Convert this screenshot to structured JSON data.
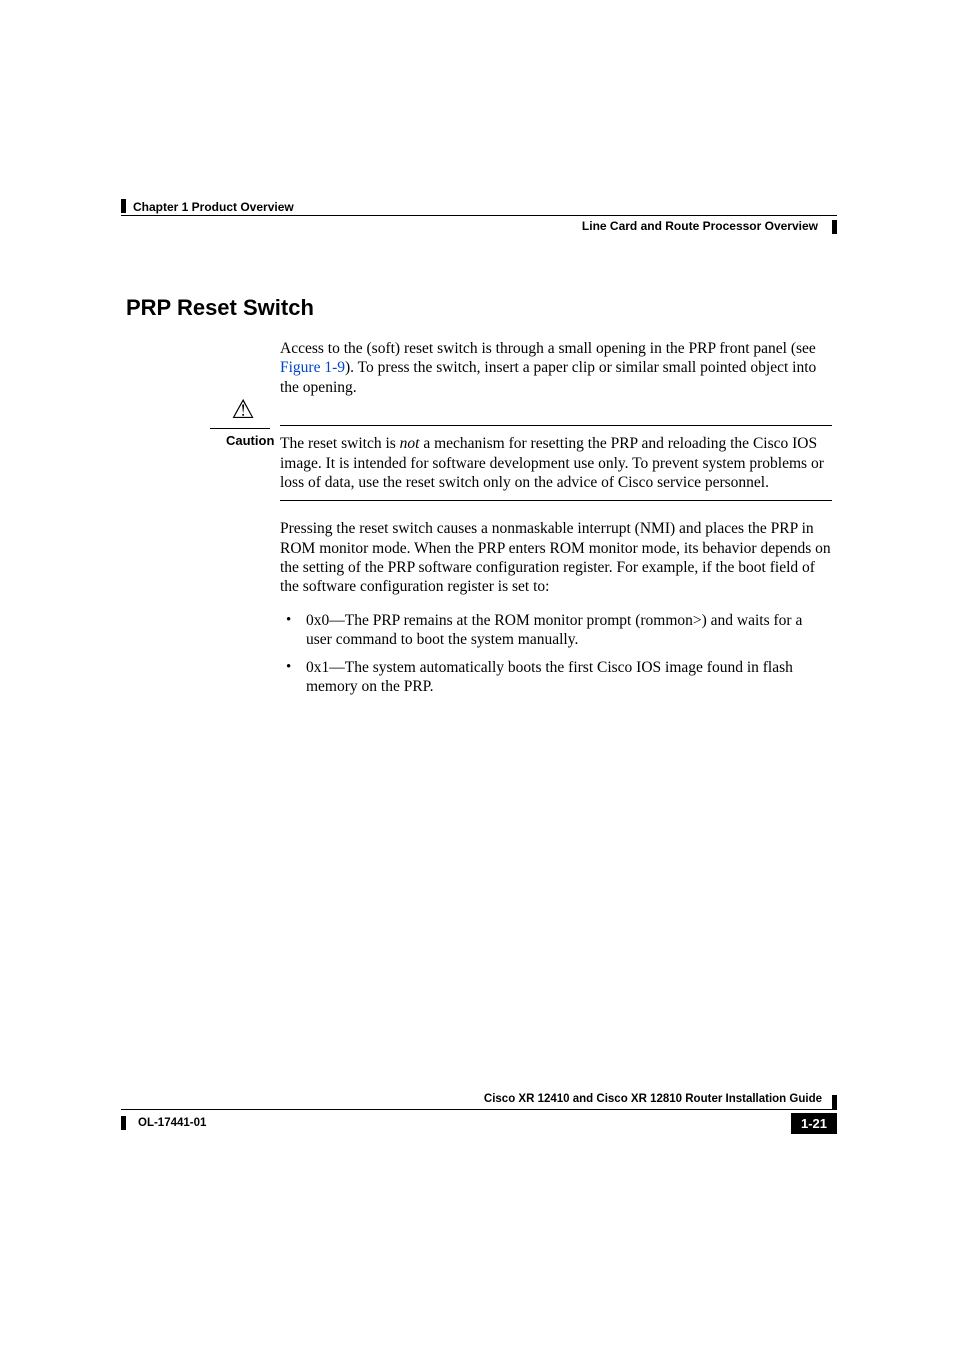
{
  "header": {
    "chapter": "Chapter 1    Product Overview",
    "section": "Line Card and Route Processor Overview"
  },
  "heading": "PRP Reset Switch",
  "intro": {
    "pre": "Access to the (soft) reset switch is through a small opening in the PRP front panel (see ",
    "link": "Figure 1-9",
    "post": "). To press the switch, insert a paper clip or similar small pointed object into the opening."
  },
  "caution": {
    "label": "Caution",
    "pre": "The reset switch is ",
    "em": "not",
    "post": " a mechanism for resetting the PRP and reloading the Cisco IOS image. It is intended for software development use only. To prevent system problems or loss of data, use the reset switch only on the advice of Cisco service personnel."
  },
  "para2": "Pressing the reset switch causes a nonmaskable interrupt (NMI) and places the PRP in ROM monitor mode. When the PRP enters ROM monitor mode, its behavior depends on the setting of the PRP software configuration register. For example, if the boot field of the software configuration register is set to:",
  "bullets": [
    "0x0—The PRP remains at the ROM monitor prompt (rommon>) and waits for a user command to boot the system manually.",
    "0x1—The system automatically boots the first Cisco IOS image found in flash memory on the PRP."
  ],
  "footer": {
    "guide": "Cisco XR 12410 and Cisco XR 12810 Router Installation Guide",
    "doc": "OL-17441-01",
    "page": "1-21"
  }
}
